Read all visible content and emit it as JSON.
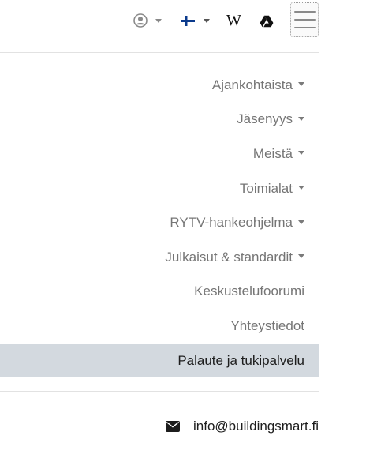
{
  "header": {
    "user_menu_icon": "user-circle-icon",
    "language_flag_icon": "finnish-flag-icon",
    "wiki_label": "W",
    "wiki_icon": "wikipedia-icon",
    "drive_icon": "google-drive-icon",
    "menu_toggle_icon": "hamburger-icon"
  },
  "nav": {
    "items": [
      {
        "label": "Ajankohtaista",
        "has_dropdown": true
      },
      {
        "label": "Jäsenyys",
        "has_dropdown": true
      },
      {
        "label": "Meistä",
        "has_dropdown": true
      },
      {
        "label": "Toimialat",
        "has_dropdown": true
      },
      {
        "label": "RYTV-hankeohjelma",
        "has_dropdown": true
      },
      {
        "label": "Julkaisut & standardit",
        "has_dropdown": true
      },
      {
        "label": "Keskustelufoorumi",
        "has_dropdown": false
      },
      {
        "label": "Yhteystiedot",
        "has_dropdown": false
      },
      {
        "label": "Palaute ja tukipalvelu",
        "has_dropdown": false,
        "active": true
      }
    ]
  },
  "footer": {
    "email": "info@buildingsmart.fi",
    "email_icon": "envelope-icon"
  },
  "colors": {
    "nav_text": "#757575",
    "active_bg": "#d3d9df",
    "active_text": "#1d1d1d",
    "flag_blue": "#0b3a8c"
  }
}
